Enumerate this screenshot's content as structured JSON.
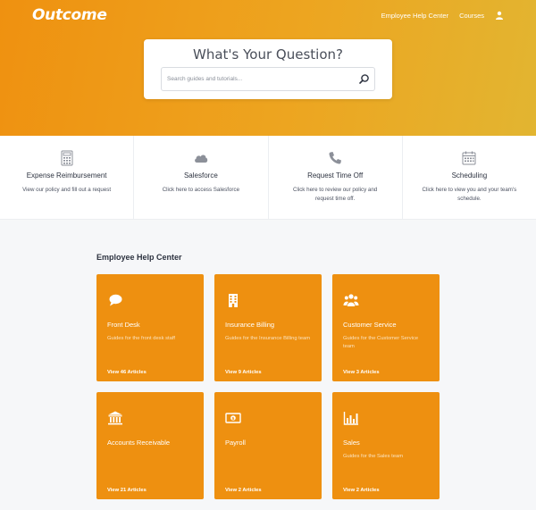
{
  "header": {
    "logo": "Outcome",
    "nav": [
      {
        "label": "Employee Help Center"
      },
      {
        "label": "Courses"
      }
    ],
    "user_icon": "user-icon"
  },
  "search": {
    "title": "What's Your Question?",
    "placeholder": "Search guides and tutorials...",
    "icon": "search-icon"
  },
  "quick_links": [
    {
      "icon": "calculator-icon",
      "title": "Expense Reimbursement",
      "desc": "View our policy and fill out a request"
    },
    {
      "icon": "cloud-icon",
      "title": "Salesforce",
      "desc": "Click here to access Salesforce"
    },
    {
      "icon": "phone-icon",
      "title": "Request Time Off",
      "desc": "Click here to review our policy and request time off."
    },
    {
      "icon": "calendar-icon",
      "title": "Scheduling",
      "desc": "Click here to view you and your team's schedule."
    }
  ],
  "section": {
    "title": "Employee Help Center"
  },
  "categories": [
    {
      "icon": "chat-bubble-icon",
      "title": "Front Desk",
      "desc": "Guides for the front desk staff",
      "link": "View 46 Articles"
    },
    {
      "icon": "building-icon",
      "title": "Insurance Billing",
      "desc": "Guides for the Insurance Billing team",
      "link": "View 9 Articles"
    },
    {
      "icon": "users-icon",
      "title": "Customer Service",
      "desc": "Guides for the Customer Service team",
      "link": "View 3 Articles"
    },
    {
      "icon": "bank-icon",
      "title": "Accounts Receivable",
      "desc": "",
      "link": "View 21 Articles"
    },
    {
      "icon": "money-icon",
      "title": "Payroll",
      "desc": "",
      "link": "View 2 Articles"
    },
    {
      "icon": "bar-chart-icon",
      "title": "Sales",
      "desc": "Guides for the Sales team",
      "link": "View 2 Articles"
    }
  ],
  "colors": {
    "accent": "#ee9010",
    "hero_end": "#e2b531",
    "text": "#2d3340",
    "background": "#f6f7f9"
  }
}
